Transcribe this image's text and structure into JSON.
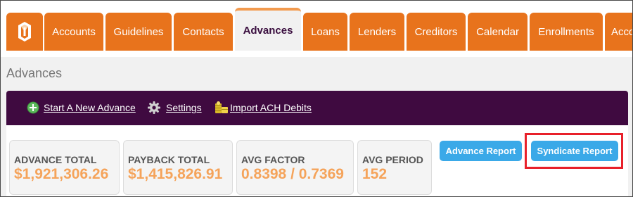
{
  "tabs": [
    {
      "label": "Accounts",
      "active": false
    },
    {
      "label": "Guidelines",
      "active": false
    },
    {
      "label": "Contacts",
      "active": false
    },
    {
      "label": "Advances",
      "active": true
    },
    {
      "label": "Loans",
      "active": false
    },
    {
      "label": "Lenders",
      "active": false
    },
    {
      "label": "Creditors",
      "active": false
    },
    {
      "label": "Calendar",
      "active": false
    },
    {
      "label": "Enrollments",
      "active": false
    },
    {
      "label": "Acco",
      "active": false
    }
  ],
  "page_title": "Advances",
  "toolbar": {
    "start_advance": "Start A New Advance",
    "settings": "Settings",
    "import_ach": "Import ACH Debits"
  },
  "stats": [
    {
      "label": "ADVANCE TOTAL",
      "value": "$1,921,306.26"
    },
    {
      "label": "PAYBACK TOTAL",
      "value": "$1,415,826.91"
    },
    {
      "label": "AVG FACTOR",
      "value": "0.8398 / 0.7369"
    },
    {
      "label": "AVG PERIOD",
      "value": "152"
    }
  ],
  "buttons": {
    "advance_report": "Advance Report",
    "syndicate_report": "Syndicate Report"
  },
  "colors": {
    "tab_orange": "#e8731c",
    "toolbar_purple": "#3f0a40",
    "stat_value_orange": "#f5a35a",
    "button_blue": "#3aa9e8",
    "highlight_red": "#e8202a"
  }
}
